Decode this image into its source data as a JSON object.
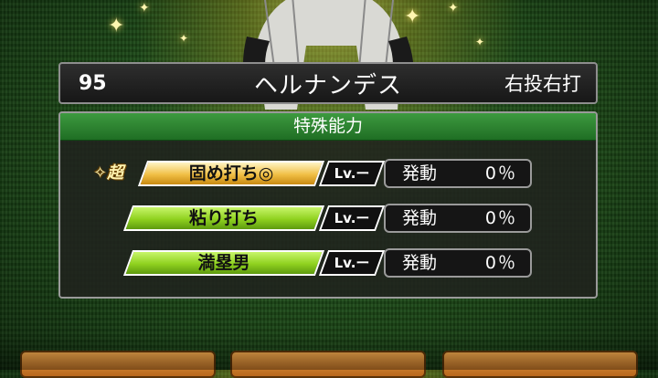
{
  "player": {
    "number": "95",
    "name": "ヘルナンデス",
    "throws_bats": "右投右打"
  },
  "panel": {
    "title": "特殊能力",
    "abilities": [
      {
        "badge": "✧超",
        "name": "固め打ち◎",
        "level": "Lv.ー",
        "rate_label": "発動",
        "rate_value": "0％",
        "tier": "gold"
      },
      {
        "badge": "",
        "name": "粘り打ち",
        "level": "Lv.ー",
        "rate_label": "発動",
        "rate_value": "0％",
        "tier": "green"
      },
      {
        "badge": "",
        "name": "満塁男",
        "level": "Lv.ー",
        "rate_label": "発動",
        "rate_value": "0％",
        "tier": "green"
      }
    ]
  },
  "colors": {
    "header_green": "#2f8a34",
    "tag_gold": "#f0bf45",
    "tag_green": "#8fd11f",
    "button_orange": "#d88a35"
  },
  "icons": [
    "sparkle-icon",
    "star-badge-icon"
  ]
}
